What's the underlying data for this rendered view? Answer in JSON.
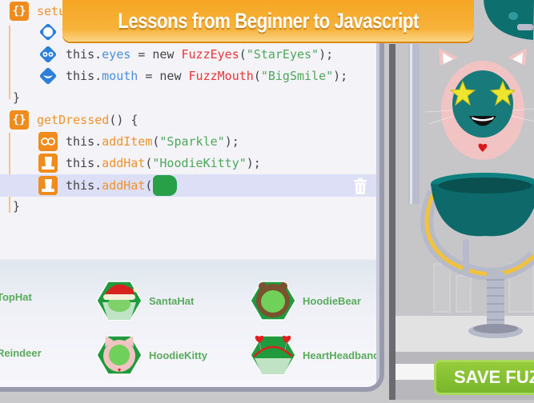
{
  "banner": {
    "title": "Lessons from Beginner to Javascript"
  },
  "editor": {
    "lines": [
      {
        "id": "setup",
        "parts": [
          {
            "t": "setu",
            "c": "k-orange"
          }
        ]
      },
      {
        "id": "body",
        "parts": []
      },
      {
        "id": "eyes",
        "parts": [
          {
            "t": "this.",
            "c": "k-dark"
          },
          {
            "t": "eyes",
            "c": "k-blue"
          },
          {
            "t": " = new ",
            "c": "k-dark"
          },
          {
            "t": "FuzzEyes",
            "c": "k-red"
          },
          {
            "t": "(",
            "c": "k-dark"
          },
          {
            "t": "\"StarEyes\"",
            "c": "k-green"
          },
          {
            "t": ");",
            "c": "k-dark"
          }
        ]
      },
      {
        "id": "mouth",
        "parts": [
          {
            "t": "this.",
            "c": "k-dark"
          },
          {
            "t": "mouth",
            "c": "k-blue"
          },
          {
            "t": " = new ",
            "c": "k-dark"
          },
          {
            "t": "FuzzMouth",
            "c": "k-red"
          },
          {
            "t": "(",
            "c": "k-dark"
          },
          {
            "t": "\"BigSmile\"",
            "c": "k-green"
          },
          {
            "t": ");",
            "c": "k-dark"
          }
        ]
      },
      {
        "id": "close1",
        "parts": [
          {
            "t": "}",
            "c": "k-dark"
          }
        ]
      },
      {
        "id": "getDressed",
        "parts": [
          {
            "t": "getDressed",
            "c": "k-orange"
          },
          {
            "t": "() {",
            "c": "k-dark"
          }
        ]
      },
      {
        "id": "addItem",
        "parts": [
          {
            "t": "this.",
            "c": "k-dark"
          },
          {
            "t": "addItem",
            "c": "k-orange"
          },
          {
            "t": "(",
            "c": "k-dark"
          },
          {
            "t": "\"Sparkle\"",
            "c": "k-green"
          },
          {
            "t": ");",
            "c": "k-dark"
          }
        ]
      },
      {
        "id": "addHat1",
        "parts": [
          {
            "t": "this.",
            "c": "k-dark"
          },
          {
            "t": "addHat",
            "c": "k-orange"
          },
          {
            "t": "(",
            "c": "k-dark"
          },
          {
            "t": "\"HoodieKitty\"",
            "c": "k-green"
          },
          {
            "t": ");",
            "c": "k-dark"
          }
        ]
      },
      {
        "id": "addHat2",
        "parts": [
          {
            "t": "this.",
            "c": "k-dark"
          },
          {
            "t": "addHat",
            "c": "k-orange"
          },
          {
            "t": "(",
            "c": "k-dark"
          }
        ]
      },
      {
        "id": "close2",
        "parts": [
          {
            "t": "}",
            "c": "k-dark"
          }
        ]
      }
    ],
    "icons": {
      "setup": "curly-braces-icon",
      "body": "diamond-body-icon",
      "eyes": "diamond-eyes-icon",
      "mouth": "diamond-mouth-icon",
      "getDressed": "curly-braces-icon",
      "addItem": "glasses-icon",
      "addHat": "hat-icon",
      "trash": "trash-icon"
    }
  },
  "palette": {
    "items": [
      {
        "label": "TopHat",
        "icon": "tophat-icon"
      },
      {
        "label": "SantaHat",
        "icon": "santa-hat-icon"
      },
      {
        "label": "HoodieBear",
        "icon": "hoodie-bear-icon"
      },
      {
        "label": "Reindeer",
        "icon": "reindeer-icon"
      },
      {
        "label": "HoodieKitty",
        "icon": "hoodie-kitty-icon"
      },
      {
        "label": "HeartHeadband",
        "icon": "heart-headband-icon"
      }
    ]
  },
  "scene": {
    "save_button": "SAVE FUZZ"
  },
  "colors": {
    "accent_orange": "#f6a623",
    "code_orange": "#f0922f",
    "code_blue": "#4a8fe0",
    "code_red": "#e8363a",
    "code_green": "#4ea85c",
    "save_green": "#86c133",
    "label_green": "#5aaa5e"
  }
}
